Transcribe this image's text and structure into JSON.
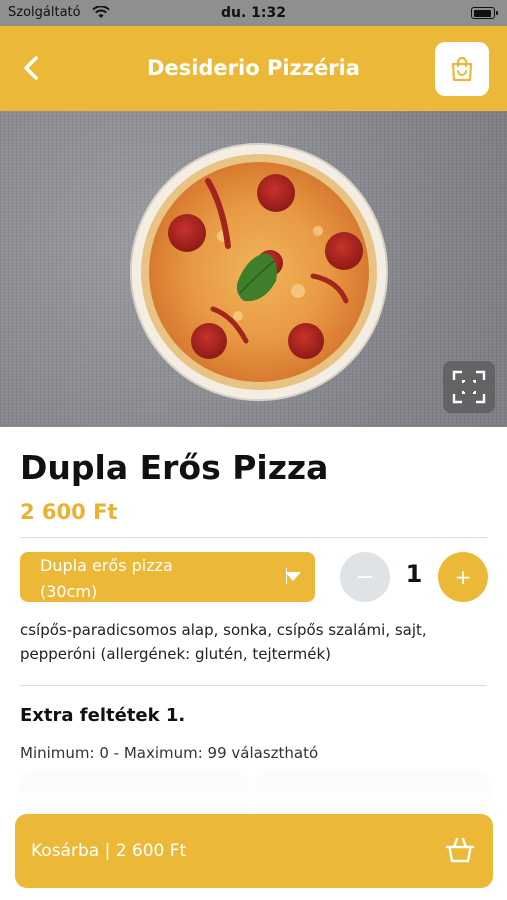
{
  "status_bar": {
    "carrier": "Szolgáltató",
    "time": "du. 1:32"
  },
  "header": {
    "title": "Desiderio Pizzéria",
    "back_icon": "chevron-left-icon",
    "cart_icon": "shopping-bag-icon"
  },
  "product": {
    "name": "Dupla Erős Pizza",
    "price": "2 600 Ft",
    "image_icon": "scan-expand-icon",
    "description": "csípős-paradicsomos alap, sonka, csípős szalámi, sajt, pepperóni (allergének: glutén, tejtermék)"
  },
  "variant": {
    "selected_line1": "Dupla erős pizza",
    "selected_line2": "(30cm)"
  },
  "quantity": {
    "minus": "−",
    "value": "1",
    "plus": "+"
  },
  "extras": {
    "title": "Extra feltétek 1.",
    "limits": "Minimum: 0 - Maximum: 99 választható"
  },
  "cart_button": {
    "label": "Kosárba | 2 600 Ft",
    "icon": "basket-icon"
  },
  "colors": {
    "accent": "#ebb937",
    "price": "#e6b22f",
    "minus_disabled": "#dfe3e6"
  }
}
